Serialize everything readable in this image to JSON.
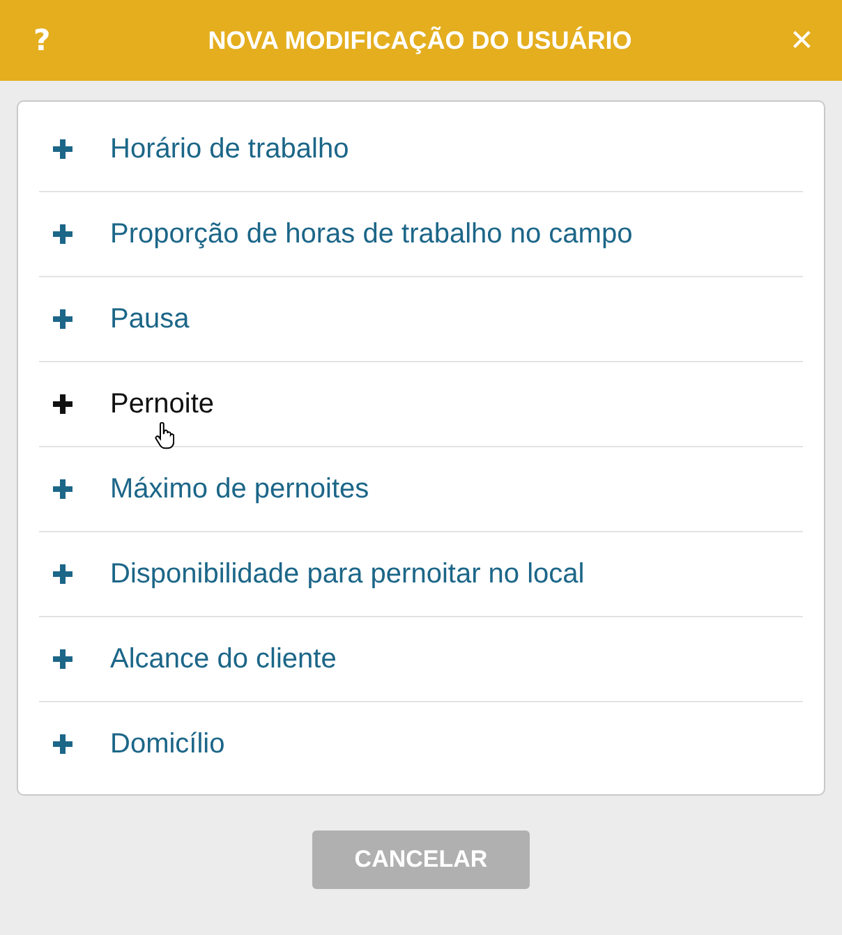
{
  "header": {
    "help": "?",
    "title": "NOVA MODIFICAÇÃO DO USUÁRIO",
    "close": "✕"
  },
  "items": [
    {
      "label": "Horário de trabalho",
      "hovered": false
    },
    {
      "label": "Proporção de horas de trabalho no campo",
      "hovered": false
    },
    {
      "label": "Pausa",
      "hovered": false
    },
    {
      "label": "Pernoite",
      "hovered": true
    },
    {
      "label": "Máximo de pernoites",
      "hovered": false
    },
    {
      "label": "Disponibilidade para pernoitar no local",
      "hovered": false
    },
    {
      "label": "Alcance do cliente",
      "hovered": false
    },
    {
      "label": "Domicílio",
      "hovered": false
    }
  ],
  "cancel": "CANCELAR"
}
